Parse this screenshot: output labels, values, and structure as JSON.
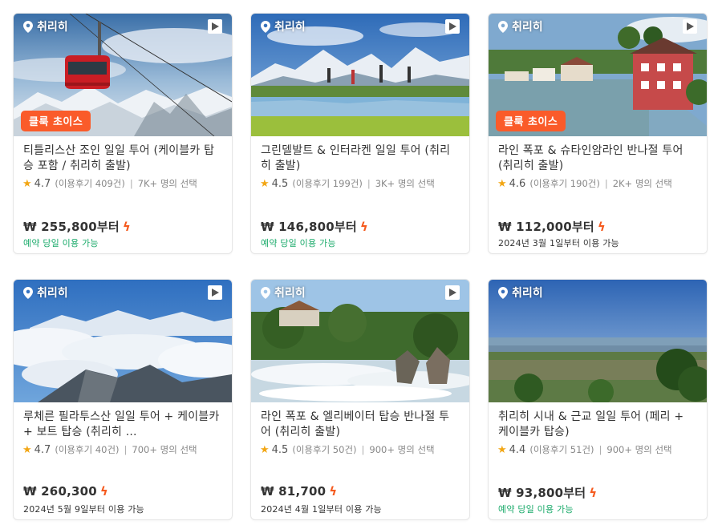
{
  "cards": [
    {
      "location": "취리히",
      "badge": "클룩 초이스",
      "title": "티틀리스산 조인 일일 투어 (케이블카 탑승 포함 / 취리히 출발)",
      "rating": "4.7",
      "reviews": "(이용후기 409건)",
      "booked": "7K+ 명의 선택",
      "price": "₩ 255,800부터",
      "availability": "예약 당일 이용 가능",
      "availability_color": "#1aaa6a"
    },
    {
      "location": "취리히",
      "title": "그린델발트 & 인터라켄 일일 투어 (취리히 출발)",
      "rating": "4.5",
      "reviews": "(이용후기 199건)",
      "booked": "3K+ 명의 선택",
      "price": "₩ 146,800부터",
      "availability": "예약 당일 이용 가능",
      "availability_color": "#1aaa6a"
    },
    {
      "location": "취리히",
      "badge": "클룩 초이스",
      "title": "라인 폭포 & 슈타인암라인 반나절 투어 (취리히 출발)",
      "rating": "4.6",
      "reviews": "(이용후기 190건)",
      "booked": "2K+ 명의 선택",
      "price": "₩ 112,000부터",
      "availability": "2024년 3월 1일부터 이용 가능",
      "availability_color": "#333333"
    },
    {
      "location": "취리히",
      "title": "루체른 필라투스산 일일 투어 + 케이블카 + 보트 탑승 (취리히 ...",
      "rating": "4.7",
      "reviews": "(이용후기 40건)",
      "booked": "700+ 명의 선택",
      "price": "₩ 260,300",
      "availability": "2024년 5월 9일부터 이용 가능",
      "availability_color": "#333333"
    },
    {
      "location": "취리히",
      "title": "라인 폭포 & 엘리베이터 탑승 반나절 투어 (취리히 출발)",
      "rating": "4.5",
      "reviews": "(이용후기 50건)",
      "booked": "900+ 명의 선택",
      "price": "₩ 81,700",
      "availability": "2024년 4월 1일부터 이용 가능",
      "availability_color": "#333333"
    },
    {
      "location": "취리히",
      "title": "취리히 시내 & 근교 일일 투어 (페리 + 케이블카 탑승)",
      "rating": "4.4",
      "reviews": "(이용후기 51건)",
      "booked": "900+ 명의 선택",
      "price": "₩ 93,800부터",
      "availability": "예약 당일 이용 가능",
      "availability_color": "#1aaa6a"
    }
  ],
  "icons": {
    "location": "map-pin-icon",
    "media": "play-icon",
    "rating": "star-icon",
    "instant": "lightning-bolt-icon"
  },
  "colors": {
    "badge": "#fa5b2a",
    "star": "#f2a614",
    "bolt": "#f55a1e",
    "same_day": "#1aaa6a"
  }
}
